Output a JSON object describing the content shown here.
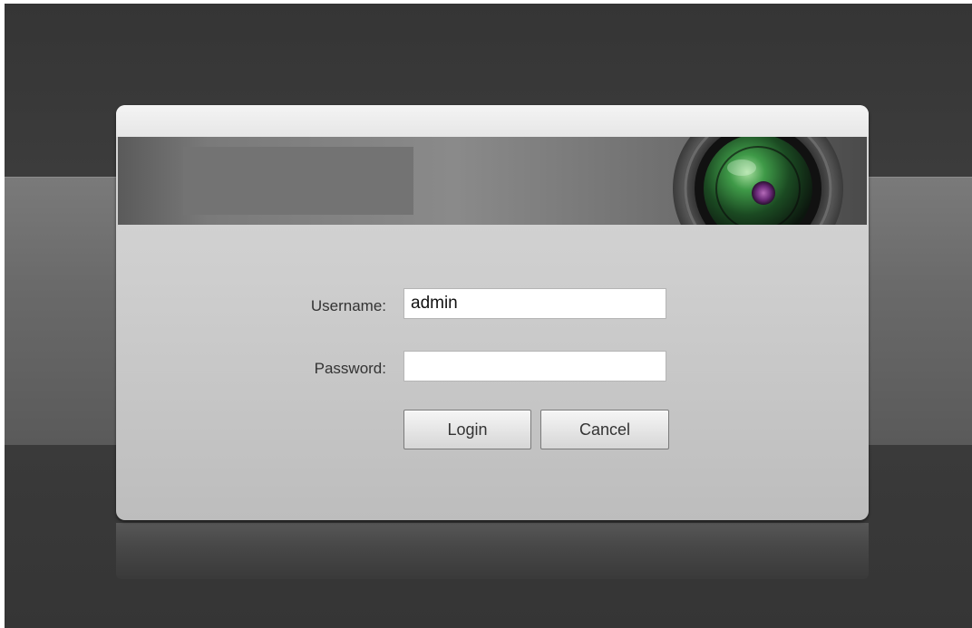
{
  "login": {
    "username_label": "Username:",
    "username_value": "admin",
    "password_label": "Password:",
    "password_value": "",
    "login_button": "Login",
    "cancel_button": "Cancel"
  },
  "colors": {
    "background": "#3a3a3a",
    "panel": "#cdcdcd",
    "banner": "#7a7a7a",
    "lens_glass": "#2f8a3a"
  },
  "icons": {
    "banner_image": "camera-lens-icon"
  }
}
